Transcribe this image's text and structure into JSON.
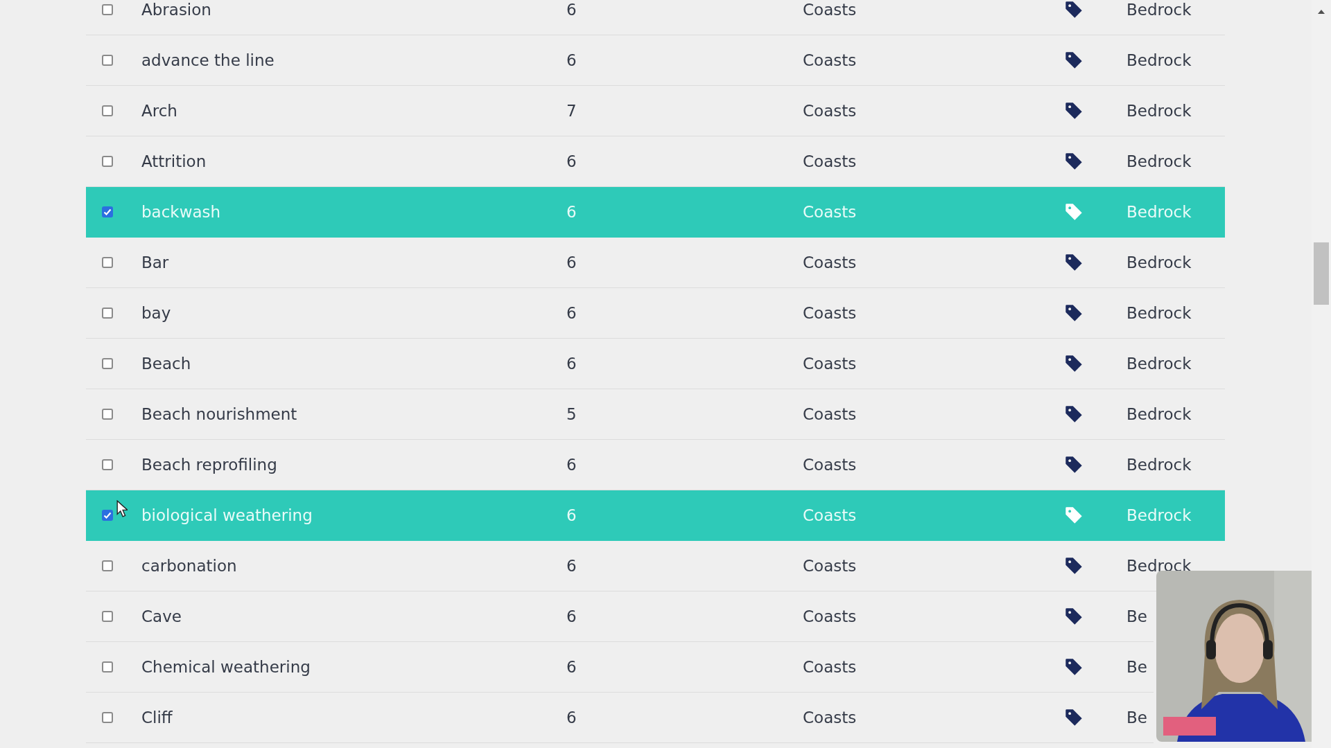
{
  "table": {
    "rows": [
      {
        "term": "Abrasion",
        "count": "6",
        "topic": "Coasts",
        "level": "Bedrock",
        "checked": false,
        "selected": false
      },
      {
        "term": "advance the line",
        "count": "6",
        "topic": "Coasts",
        "level": "Bedrock",
        "checked": false,
        "selected": false
      },
      {
        "term": "Arch",
        "count": "7",
        "topic": "Coasts",
        "level": "Bedrock",
        "checked": false,
        "selected": false
      },
      {
        "term": "Attrition",
        "count": "6",
        "topic": "Coasts",
        "level": "Bedrock",
        "checked": false,
        "selected": false
      },
      {
        "term": "backwash",
        "count": "6",
        "topic": "Coasts",
        "level": "Bedrock",
        "checked": true,
        "selected": true
      },
      {
        "term": "Bar",
        "count": "6",
        "topic": "Coasts",
        "level": "Bedrock",
        "checked": false,
        "selected": false
      },
      {
        "term": "bay",
        "count": "6",
        "topic": "Coasts",
        "level": "Bedrock",
        "checked": false,
        "selected": false
      },
      {
        "term": "Beach",
        "count": "6",
        "topic": "Coasts",
        "level": "Bedrock",
        "checked": false,
        "selected": false
      },
      {
        "term": "Beach nourishment",
        "count": "5",
        "topic": "Coasts",
        "level": "Bedrock",
        "checked": false,
        "selected": false
      },
      {
        "term": "Beach reprofiling",
        "count": "6",
        "topic": "Coasts",
        "level": "Bedrock",
        "checked": false,
        "selected": false
      },
      {
        "term": "biological weathering",
        "count": "6",
        "topic": "Coasts",
        "level": "Bedrock",
        "checked": true,
        "selected": true
      },
      {
        "term": "carbonation",
        "count": "6",
        "topic": "Coasts",
        "level": "Bedrock",
        "checked": false,
        "selected": false
      },
      {
        "term": "Cave",
        "count": "6",
        "topic": "Coasts",
        "level": "Be",
        "checked": false,
        "selected": false
      },
      {
        "term": "Chemical weathering",
        "count": "6",
        "topic": "Coasts",
        "level": "Be",
        "checked": false,
        "selected": false
      },
      {
        "term": "Cliff",
        "count": "6",
        "topic": "Coasts",
        "level": "Be",
        "checked": false,
        "selected": false
      }
    ]
  }
}
